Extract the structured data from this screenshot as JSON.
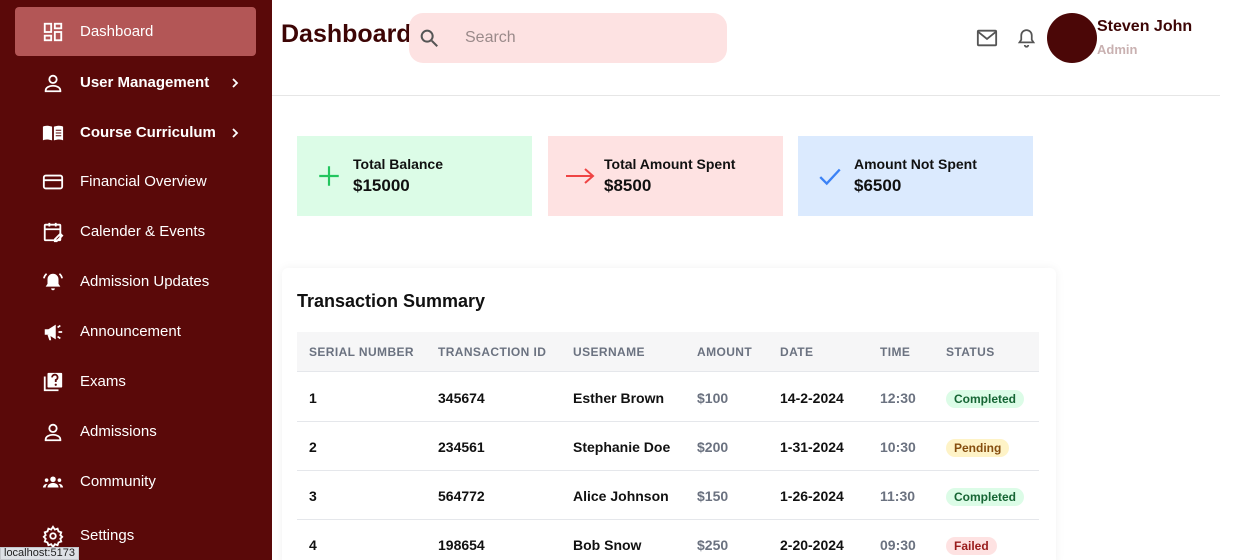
{
  "sidebar": {
    "items": [
      {
        "label": "Dashboard",
        "icon": "dashboard-icon"
      },
      {
        "label": "User Management",
        "icon": "user-icon"
      },
      {
        "label": "Course Curriculum",
        "icon": "book-icon"
      },
      {
        "label": "Financial Overview",
        "icon": "credit-card-icon"
      },
      {
        "label": "Calender & Events",
        "icon": "calendar-icon"
      },
      {
        "label": "Admission Updates",
        "icon": "alarm-bell-icon"
      },
      {
        "label": "Announcement",
        "icon": "megaphone-icon"
      },
      {
        "label": "Exams",
        "icon": "quiz-icon"
      },
      {
        "label": "Admissions",
        "icon": "person-icon"
      },
      {
        "label": "Community",
        "icon": "group-icon"
      },
      {
        "label": "Settings",
        "icon": "gear-icon"
      }
    ]
  },
  "status_bar": {
    "url": "localhost:5173"
  },
  "header": {
    "title": "Dashboard",
    "search_placeholder": "Search",
    "user_name": "Steven John",
    "user_role": "Admin"
  },
  "cards": [
    {
      "label": "Total Balance",
      "value": "$15000",
      "icon": "plus-icon",
      "color": "#22c55e",
      "bg": "#dcfce7"
    },
    {
      "label": "Total Amount Spent",
      "value": "$8500",
      "icon": "arrow-right-icon",
      "color": "#ef4444",
      "bg": "#fee2e2"
    },
    {
      "label": "Amount Not Spent",
      "value": "$6500",
      "icon": "check-icon",
      "color": "#3b82f6",
      "bg": "#dbeafe"
    }
  ],
  "transactions": {
    "title": "Transaction Summary",
    "columns": [
      "SERIAL NUMBER",
      "TRANSACTION ID",
      "USERNAME",
      "AMOUNT",
      "DATE",
      "TIME",
      "STATUS"
    ],
    "rows": [
      {
        "serial": "1",
        "id": "345674",
        "username": "Esther Brown",
        "amount": "$100",
        "date": "14-2-2024",
        "time": "12:30",
        "status": "Completed"
      },
      {
        "serial": "2",
        "id": "234561",
        "username": "Stephanie Doe",
        "amount": "$200",
        "date": "1-31-2024",
        "time": "10:30",
        "status": "Pending"
      },
      {
        "serial": "3",
        "id": "564772",
        "username": "Alice Johnson",
        "amount": "$150",
        "date": "1-26-2024",
        "time": "11:30",
        "status": "Completed"
      },
      {
        "serial": "4",
        "id": "198654",
        "username": "Bob Snow",
        "amount": "$250",
        "date": "2-20-2024",
        "time": "09:30",
        "status": "Failed"
      }
    ]
  }
}
